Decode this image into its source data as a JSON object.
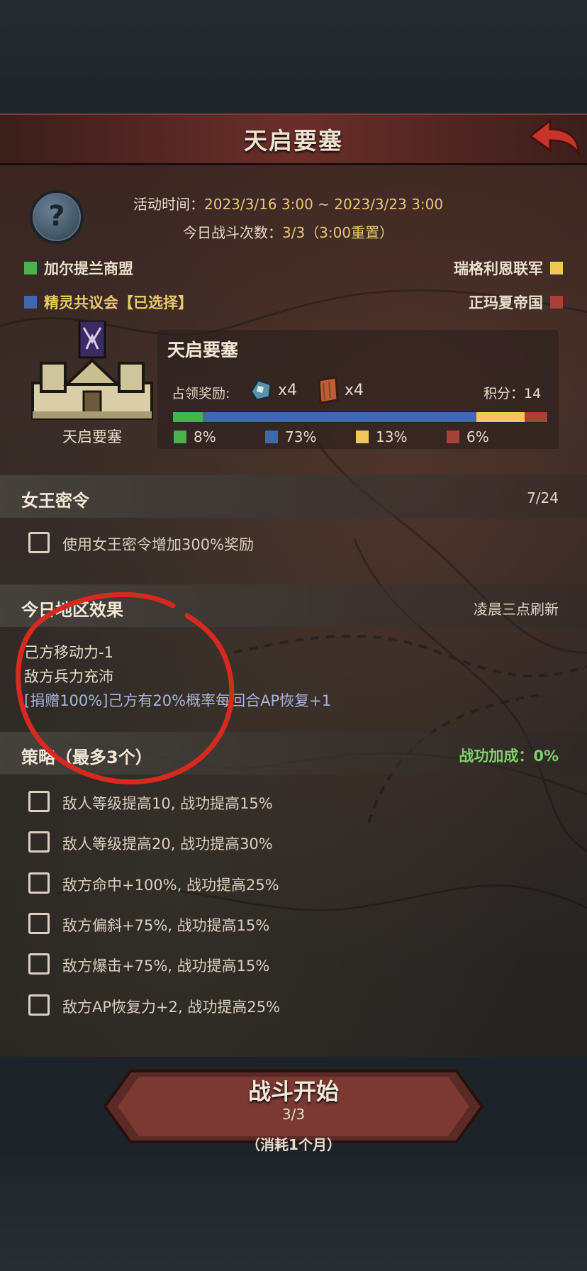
{
  "header": {
    "title": "天启要塞"
  },
  "activity": {
    "time_label": "活动时间：",
    "time_value": "2023/3/16 3:00 ~ 2023/3/23 3:00",
    "battles_label": "今日战斗次数：",
    "battles_value": "3/3（3:00重置）"
  },
  "factions": [
    {
      "name": "加尔提兰商盟",
      "color": "#4caf50"
    },
    {
      "name": "瑞格利恩联军",
      "color": "#f1c75b"
    },
    {
      "name": "精灵共议会【已选择】",
      "color": "#3f69a8"
    },
    {
      "name": "正玛夏帝国",
      "color": "#a9403a"
    }
  ],
  "fortress": {
    "icon_caption": "天启要塞",
    "name": "天启要塞",
    "reward_label": "占领奖励:",
    "reward1_qty": "x4",
    "reward2_qty": "x4",
    "score_text": "积分：14",
    "shares": [
      {
        "label": "8%",
        "value": 8,
        "color": "#4caf50"
      },
      {
        "label": "73%",
        "value": 73,
        "color": "#3f69a8"
      },
      {
        "label": "13%",
        "value": 13,
        "color": "#f1c75b"
      },
      {
        "label": "6%",
        "value": 6,
        "color": "#a9403a"
      }
    ]
  },
  "queen_order": {
    "title": "女王密令",
    "count": "7/24",
    "option": "使用女王密令增加300%奖励"
  },
  "region_effects": {
    "title": "今日地区效果",
    "refresh": "凌晨三点刷新",
    "lines": [
      "己方移动力-1",
      "敌方兵力充沛",
      "[捐赠100%]己方有20%概率每回合AP恢复+1"
    ]
  },
  "strategy": {
    "title": "策略（最多3个）",
    "bonus": "战功加成：0%",
    "options": [
      "敌人等级提高10, 战功提高15%",
      "敌人等级提高20, 战功提高30%",
      "敌方命中+100%, 战功提高25%",
      "敌方偏斜+75%, 战功提高15%",
      "敌方爆击+75%, 战功提高15%",
      "敌方AP恢复力+2, 战功提高25%"
    ]
  },
  "start": {
    "label": "战斗开始",
    "count": "3/3",
    "cost": "（消耗1个月）"
  },
  "colors": {
    "annotation_circle": "#d8291f",
    "accent_gold": "#e4c877"
  }
}
